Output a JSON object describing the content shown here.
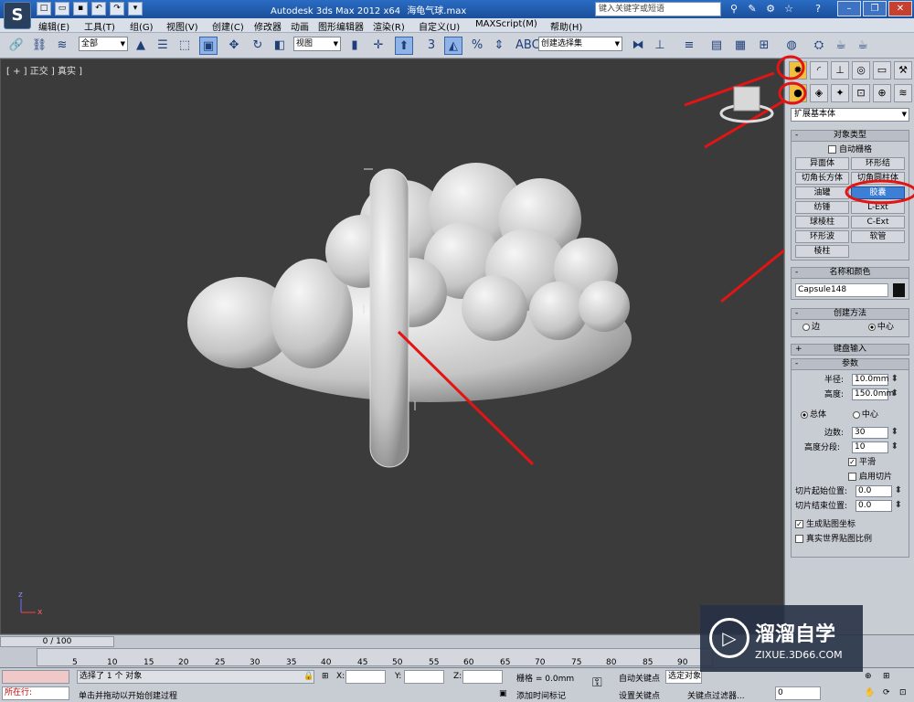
{
  "titlebar": {
    "app_title": "Autodesk 3ds Max  2012 x64",
    "file_name": "海龟气球.max",
    "search_placeholder": "键入关键字或短语",
    "app_icon_glyph": "S"
  },
  "menu": [
    "编辑(E)",
    "工具(T)",
    "组(G)",
    "视图(V)",
    "创建(C)",
    "修改器",
    "动画",
    "图形编辑器",
    "渲染(R)",
    "自定义(U)",
    "MAXScript(M)",
    "帮助(H)"
  ],
  "toolbar": {
    "selection_filter": "全部",
    "reference_coord": "视图",
    "named_selection": "创建选择集",
    "snap_label": "3"
  },
  "viewport": {
    "label": "[ + ] 正交 ] 真实 ]",
    "axis_z": "z",
    "axis_x": "x"
  },
  "command_panel": {
    "category": "扩展基本体",
    "object_type": {
      "title": "对象类型",
      "autogrid": "自动栅格",
      "buttons": [
        "异面体",
        "环形结",
        "切角长方体",
        "切角圆柱体",
        "油罐",
        "胶囊",
        "纺锤",
        "L-Ext",
        "球棱柱",
        "C-Ext",
        "环形波",
        "软管",
        "棱柱"
      ]
    },
    "name_color": {
      "title": "名称和颜色",
      "name_value": "Capsule148"
    },
    "creation_method": {
      "title": "创建方法",
      "edge": "边",
      "center": "中心"
    },
    "keyboard_entry": {
      "title": "键盘输入"
    },
    "parameters": {
      "title": "参数",
      "radius_label": "半径:",
      "radius_value": "10.0mm",
      "height_label": "高度:",
      "height_value": "150.0mm",
      "overall": "总体",
      "center": "中心",
      "sides_label": "边数:",
      "sides_value": "30",
      "height_segs_label": "高度分段:",
      "height_segs_value": "10",
      "smooth": "平滑",
      "slice_on": "启用切片",
      "slice_from_label": "切片起始位置:",
      "slice_from_value": "0.0",
      "slice_to_label": "切片结束位置:",
      "slice_to_value": "0.0",
      "gen_map": "生成贴图坐标",
      "real_world": "真实世界贴图比例"
    }
  },
  "timeline": {
    "frame_counter": "0 / 100",
    "ticks": [
      "5",
      "10",
      "15",
      "20",
      "25",
      "30",
      "35",
      "40",
      "45",
      "50",
      "55",
      "60",
      "65",
      "70",
      "75",
      "80",
      "85",
      "90"
    ]
  },
  "status": {
    "selection": "选择了 1 个 对象",
    "prompt": "单击并拖动以开始创建过程",
    "mode": "所在行:",
    "x_label": "X:",
    "y_label": "Y:",
    "z_label": "Z:",
    "grid": "栅格 = 0.0mm",
    "add_time_tag": "添加时间标记",
    "auto_key": "自动关键点",
    "selected": "选定对象",
    "set_key": "设置关键点",
    "key_filters": "关键点过滤器...",
    "frame_value": "0"
  },
  "watermark": {
    "brand": "溜溜自学",
    "url": "ZIXUE.3D66.COM"
  }
}
